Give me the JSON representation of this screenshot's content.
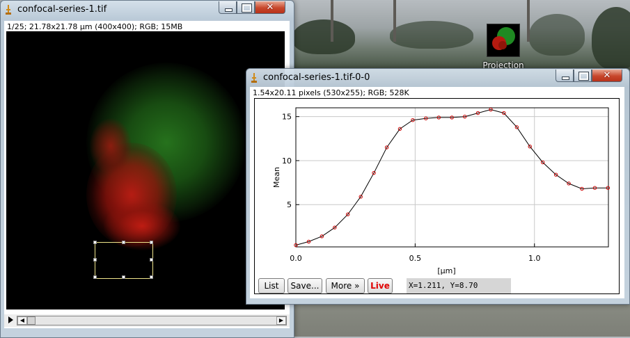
{
  "desktop": {
    "icon_label": "Projection"
  },
  "image_window": {
    "title": "confocal-series-1.tif",
    "info": "1/25; 21.78x21.78 µm (400x400); RGB; 15MB",
    "scroll_left": "◀",
    "scroll_right": "▶"
  },
  "plot_window": {
    "title": "confocal-series-1.tif-0-0",
    "info": "1.54x20.11 pixels (530x255); RGB; 528K",
    "buttons": {
      "list": "List",
      "save": "Save...",
      "more": "More »",
      "live": "Live"
    },
    "coordinates": "X=1.211, Y=8.70"
  },
  "colors": {
    "live_text": "#e00000",
    "plot_line": "#000000",
    "plot_marker": "#cc0000",
    "grid": "#c8c8c8"
  },
  "chart_data": {
    "type": "line",
    "title": "",
    "xlabel": "[µm]",
    "ylabel": "Mean",
    "xlim": [
      0,
      1.31
    ],
    "ylim": [
      0.2,
      16
    ],
    "xticks": [
      0.0,
      0.5,
      1.0
    ],
    "xtick_labels": [
      "0.0",
      "0.5",
      "1.0"
    ],
    "yticks": [
      5,
      10,
      15
    ],
    "ytick_labels": [
      "5",
      "10",
      "15"
    ],
    "grid": true,
    "series": [
      {
        "x": [
          0.0,
          0.054,
          0.109,
          0.163,
          0.218,
          0.272,
          0.327,
          0.381,
          0.436,
          0.49,
          0.545,
          0.599,
          0.654,
          0.708,
          0.763,
          0.817,
          0.872,
          0.926,
          0.981,
          1.035,
          1.09,
          1.144,
          1.199,
          1.253,
          1.308
        ],
        "y": [
          0.4,
          0.8,
          1.4,
          2.4,
          3.9,
          5.9,
          8.6,
          11.5,
          13.6,
          14.6,
          14.8,
          14.9,
          14.9,
          15.0,
          15.4,
          15.8,
          15.4,
          13.8,
          11.6,
          9.8,
          8.4,
          7.4,
          6.8,
          6.9,
          6.9
        ]
      }
    ]
  }
}
